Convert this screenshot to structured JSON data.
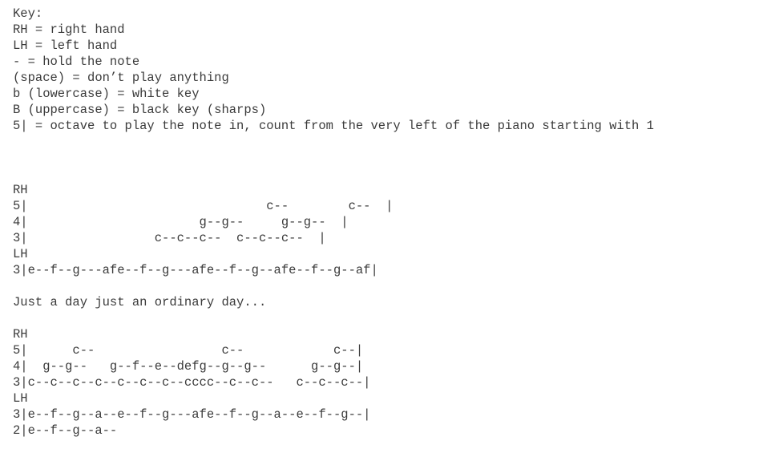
{
  "key": {
    "lines": [
      "Key:",
      "RH = right hand",
      "LH = left hand",
      "- = hold the note",
      "(space) = don’t play anything",
      "b (lowercase) = white key",
      "B (uppercase) = black key (sharps)",
      "5| = octave to play the note in, count from the very left of the piano starting with 1"
    ]
  },
  "section1": {
    "rh_label": "RH",
    "rh_lines": [
      "5|                                c--        c--  |",
      "4|                       g--g--     g--g--  |",
      "3|                 c--c--c--  c--c--c--  |"
    ],
    "lh_label": "LH",
    "lh_lines": [
      "3|e--f--g---afe--f--g---afe--f--g--afe--f--g--af|"
    ]
  },
  "lyric": "Just a day just an ordinary day...",
  "section2": {
    "rh_label": "RH",
    "rh_lines": [
      "5|      c--                 c--            c--|",
      "4|  g--g--   g--f--e--defg--g--g--      g--g--|",
      "3|c--c--c--c--c--c--c--cccc--c--c--   c--c--c--|"
    ],
    "lh_label": "LH",
    "lh_lines": [
      "3|e--f--g--a--e--f--g---afe--f--g--a--e--f--g--|",
      "2|e--f--g--a--"
    ]
  }
}
